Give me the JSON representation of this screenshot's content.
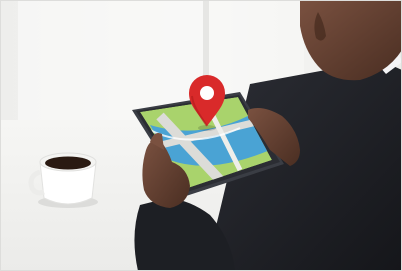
{
  "photo": {
    "subject": "person-holding-tablet-with-map",
    "colors": {
      "background": "#f1f1ef",
      "window_light": "#fafaf8",
      "table": "#f3f3f1",
      "suit": "#24262c",
      "suit_shadow": "#16171b",
      "skin": "#6a4636",
      "skin_dark": "#4a2e22",
      "shirt": "#f4f4f6",
      "tablet_frame": "#3a3d44",
      "map_green": "#a9d36c",
      "map_blue": "#4aa3d4",
      "map_road": "#dcdcd8",
      "pin_red": "#d92a2a",
      "cup": "#ffffff",
      "coffee": "#2a1a12"
    },
    "icons": [
      "location-pin-icon"
    ]
  }
}
